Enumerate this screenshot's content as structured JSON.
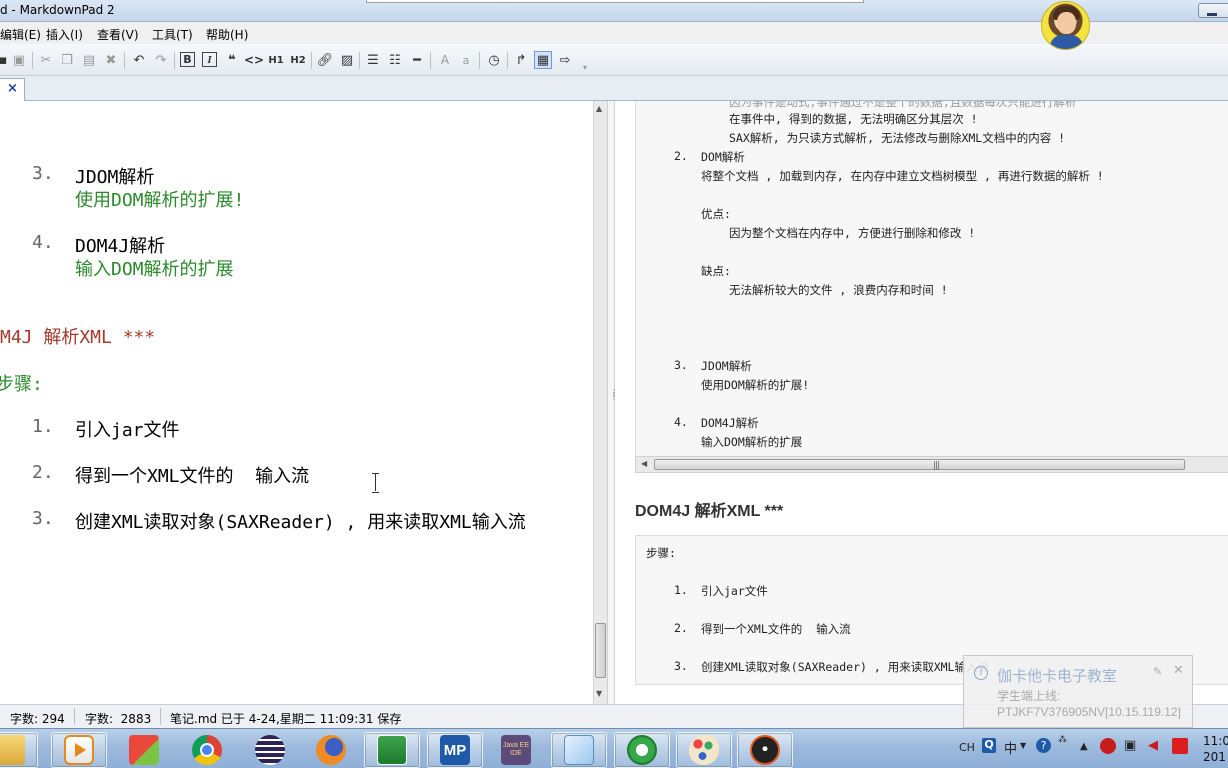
{
  "window": {
    "title": "d - MarkdownPad 2"
  },
  "menu": {
    "items": [
      "编辑(E)",
      "插入(I)",
      "查看(V)",
      "工具(T)",
      "帮助(H)"
    ]
  },
  "toolbar": {
    "h1_label": "H1",
    "h2_label": "H2",
    "bold_label": "B",
    "italic_label": "I",
    "font_larger": "A",
    "font_smaller": "a"
  },
  "tab": {
    "close_glyph": "×"
  },
  "editor": {
    "lines": {
      "l1_num": "3.",
      "l1_text": "JDOM解析",
      "l1_sub": "使用DOM解析的扩展!",
      "l2_num": "4.",
      "l2_text": "DOM4J解析",
      "l2_sub": "输入DOM解析的扩展",
      "heading": "M4J 解析XML ***",
      "steps_label": "步骤:",
      "s1_num": "1.",
      "s1_text": "引入jar文件",
      "s2_num": "2.",
      "s2_text": "得到一个XML文件的  输入流",
      "s3_num": "3.",
      "s3_text": "创建XML读取对象(SAXReader) , 用来读取XML输入流"
    }
  },
  "preview": {
    "box1": {
      "l0": "因为事件是动式,事件通过不是整个的数据,且数据每次只能进行解析",
      "l1": "在事件中, 得到的数据, 无法明确区分其层次 !",
      "l2": "SAX解析, 为只读方式解析, 无法修改与删除XML文档中的内容 !",
      "l3_num": "2.",
      "l3": "DOM解析",
      "l4": "将整个文档 , 加载到内存, 在内存中建立文档树模型 , 再进行数据的解析 !",
      "l5": "优点:",
      "l6": "因为整个文档在内存中, 方便进行删除和修改 !",
      "l7": "缺点:",
      "l8": "无法解析较大的文件 , 浪费内存和时间 !",
      "l9_num": "3.",
      "l9": "JDOM解析",
      "l10": "使用DOM解析的扩展!",
      "l11_num": "4.",
      "l11": "DOM4J解析",
      "l12": "输入DOM解析的扩展"
    },
    "heading": "DOM4J 解析XML ***",
    "box2": {
      "steps": "步骤:",
      "s1_num": "1.",
      "s1": "引入jar文件",
      "s2_num": "2.",
      "s2": "得到一个XML文件的  输入流",
      "s3_num": "3.",
      "s3": "创建XML读取对象(SAXReader) , 用来读取XML输入流"
    }
  },
  "notification": {
    "title": "伽卡他卡电子教室",
    "line1": "学生端上线:",
    "line2": "PTJKF7V376905NV[10.15.119.12]"
  },
  "status": {
    "words": "字数: 294",
    "chars": "字数:  2883",
    "saved": "笔记.md 已于 4-24,星期二 11:09:31 保存"
  },
  "taskbar": {
    "ime_lang": "CH",
    "ime_mode": "中",
    "clock_time": "11:0",
    "clock_date": "201",
    "apps": [
      "file-explorer",
      "media-player",
      "pencil-tool",
      "chrome",
      "eclipse",
      "firefox",
      "remote-assist",
      "markdownpad",
      "java-ee-ide",
      "notepad",
      "ie-refresh",
      "paint",
      "ninja-tool"
    ],
    "mp_label": "MP",
    "javaee_label": "Java EE IDE"
  },
  "colors": {
    "markdown_green": "#2c8a2c",
    "markdown_heading": "#a33a2a",
    "title_bar": "#c4d6ec",
    "taskbar": "#9ab8db"
  }
}
